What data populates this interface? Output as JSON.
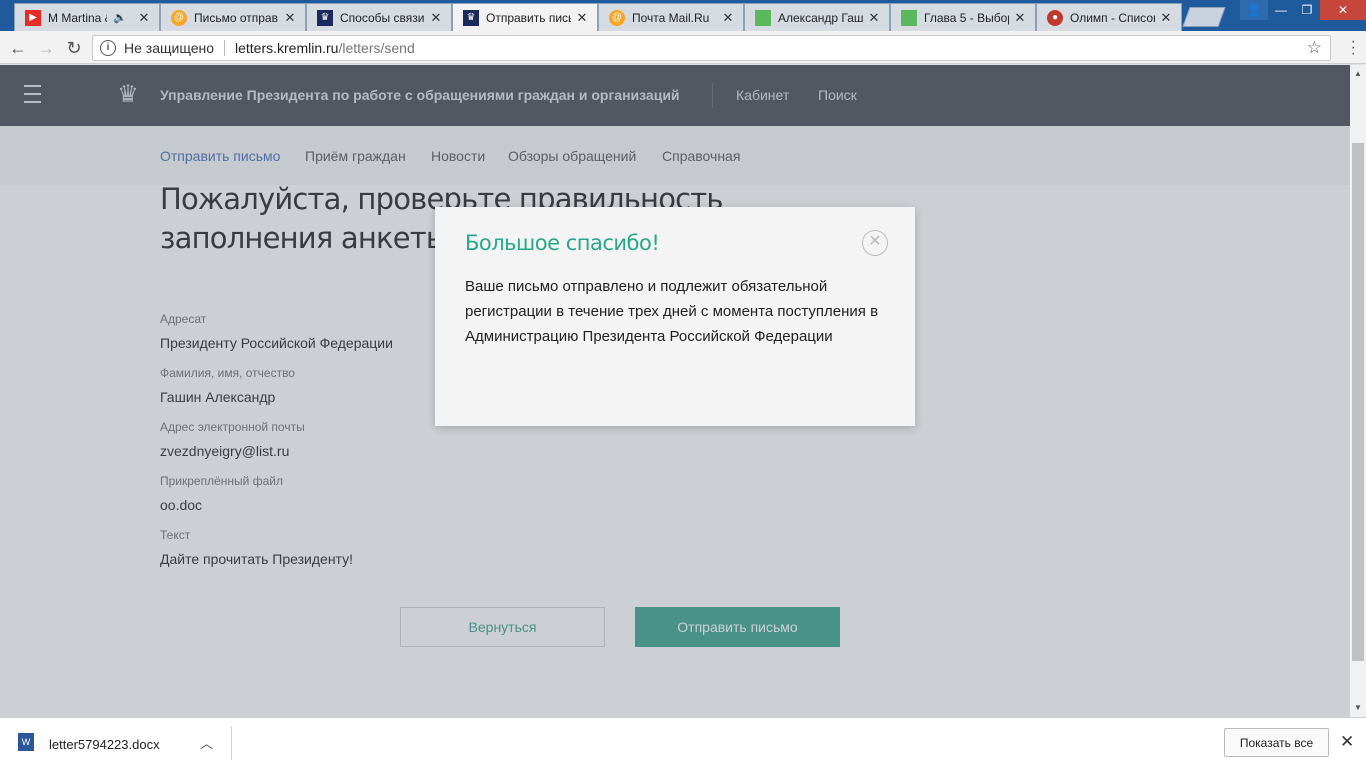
{
  "browser": {
    "tabs": [
      {
        "title": "M Martina &",
        "icon": "youtube-icon",
        "color": "#e52d27",
        "audio": true
      },
      {
        "title": "Письмо отправ",
        "icon": "mail-at-icon",
        "color": "#f5a623"
      },
      {
        "title": "Способы связи",
        "icon": "kremlin-emblem-icon",
        "color": "#1a2a5a"
      },
      {
        "title": "Отправить письмо",
        "icon": "kremlin-emblem-icon",
        "color": "#1a2a5a",
        "active": true
      },
      {
        "title": "Почта Mail.Ru",
        "icon": "mail-at-icon",
        "color": "#f5a623"
      },
      {
        "title": "Александр Гаш",
        "icon": "sheet-icon",
        "color": "#5cb85c"
      },
      {
        "title": "Глава 5 - Выбор",
        "icon": "sheet-icon",
        "color": "#5cb85c"
      },
      {
        "title": "Олимп - Список",
        "icon": "olymp-icon",
        "color": "#c0392b"
      }
    ],
    "security_label": "Не защищено",
    "url_host": "letters.kremlin.ru",
    "url_path": "/letters/send"
  },
  "site": {
    "title": "Управление Президента по работе с обращениями граждан и организаций",
    "header_links": [
      "Кабинет",
      "Поиск"
    ],
    "subnav": [
      "Отправить письмо",
      "Приём граждан",
      "Новости",
      "Обзоры обращений",
      "Справочная"
    ]
  },
  "page": {
    "heading": "Пожалуйста, проверьте правильность заполнения анкеты",
    "fields": [
      {
        "label": "Адресат",
        "value": "Президенту Российской Федерации"
      },
      {
        "label": "Фамилия, имя, отчество",
        "value": "Гашин Александр"
      },
      {
        "label": "Адрес электронной почты",
        "value": "zvezdnyeigry@list.ru"
      },
      {
        "label": "Прикреплённый файл",
        "value": "oo.doc"
      },
      {
        "label": "Текст",
        "value": "Дайте прочитать Президенту!"
      }
    ],
    "back_button": "Вернуться",
    "send_button": "Отправить письмо"
  },
  "modal": {
    "title": "Большое спасибо!",
    "text": "Ваше письмо отправлено и подлежит обязательной регистрации в течение трех дней с момента поступления в Администрацию Президента Российской Федерации"
  },
  "downloads": {
    "filename": "letter5794223.docx",
    "show_all": "Показать все"
  },
  "colors": {
    "accent_green": "#2a9d85",
    "header_bg": "#3a3e4a",
    "link_blue": "#3665b8"
  }
}
